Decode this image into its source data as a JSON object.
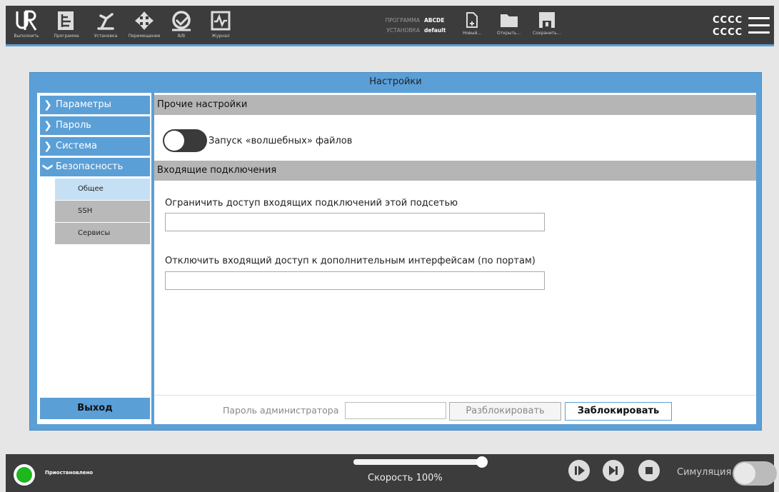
{
  "topbar": {
    "nav": [
      {
        "icon": "ur-logo-icon",
        "label": "Выполнить"
      },
      {
        "icon": "program-icon",
        "label": "Программа"
      },
      {
        "icon": "robot-arm-icon",
        "label": "Установка"
      },
      {
        "icon": "move-arrows-icon",
        "label": "Перемещение"
      },
      {
        "icon": "io-icon",
        "label": "В/В"
      },
      {
        "icon": "log-icon",
        "label": "Журнал"
      }
    ],
    "program_key": "ПРОГРАММА",
    "program_value": "ABCDE",
    "installation_key": "УСТАНОВКА",
    "installation_value": "default",
    "file_new": "Новый...",
    "file_open": "Открыть...",
    "file_save": "Сохранить...",
    "user_line1": "CCCC",
    "user_line2": "CCCC"
  },
  "dialog": {
    "title": "Настройки",
    "sidebar": {
      "items": [
        {
          "label": "Параметры",
          "expanded": false
        },
        {
          "label": "Пароль",
          "expanded": false
        },
        {
          "label": "Система",
          "expanded": false
        },
        {
          "label": "Безопасность",
          "expanded": true
        }
      ],
      "sub_items": [
        {
          "label": "Общее",
          "active": true
        },
        {
          "label": "SSH",
          "active": false
        },
        {
          "label": "Сервисы",
          "active": false
        }
      ],
      "exit_label": "Выход"
    },
    "content": {
      "section1_title": "Прочие настройки",
      "magic_files_label": "Запуск «волшебных» файлов",
      "magic_files_enabled": false,
      "section2_title": "Входящие подключения",
      "subnet_label": "Ограничить доступ входящих подключений этой подсетью",
      "subnet_value": "",
      "ports_label": "Отключить входящий доступ к дополнительным интерфейсам (по портам)",
      "ports_value": "",
      "admin_password_label": "Пароль администратора",
      "admin_password_value": "",
      "unlock_label": "Разблокировать",
      "lock_label": "Заблокировать"
    }
  },
  "bottombar": {
    "status_text": "Приостановлено",
    "status_color": "#1db81d",
    "speed_label": "Скорость 100%",
    "speed_fraction": 1.0,
    "simulation_label": "Симуляция",
    "simulation_enabled": false
  },
  "colors": {
    "accent": "#5b9fd7",
    "topbar": "#3c3c3c",
    "section_header": "#b5b5b5"
  }
}
